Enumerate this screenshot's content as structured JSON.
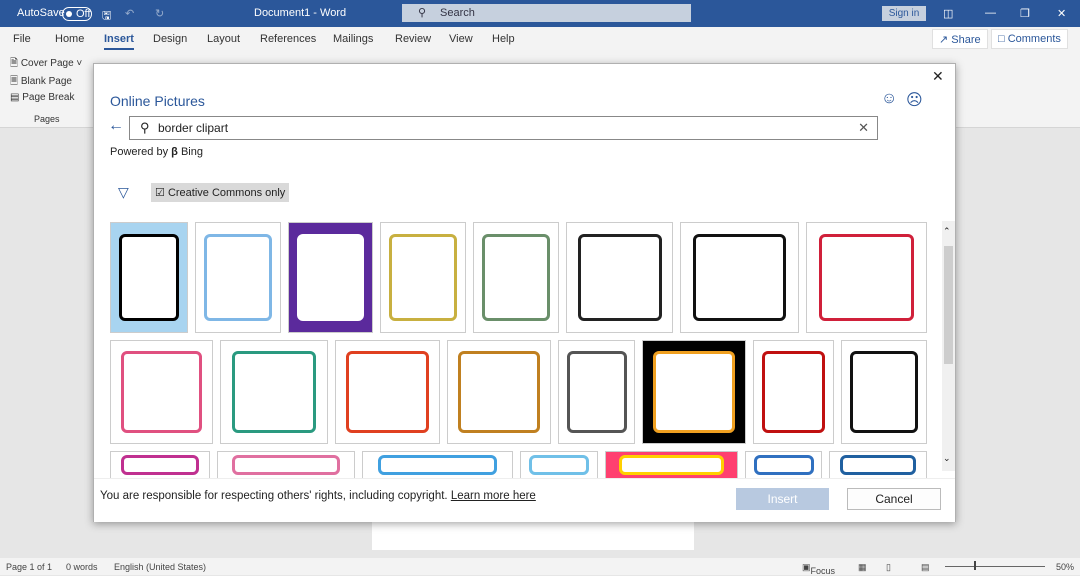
{
  "titlebar": {
    "autosave": "AutoSave",
    "toggle": "Off",
    "doc_title": "Document1 - Word",
    "search": "Search",
    "signin": "Sign in"
  },
  "tabs": [
    "File",
    "Home",
    "Insert",
    "Design",
    "Layout",
    "References",
    "Mailings",
    "Review",
    "View",
    "Help"
  ],
  "active_tab": "Insert",
  "share": "Share",
  "comments": "Comments",
  "ribbon": {
    "items": [
      "Cover Page",
      "Blank Page",
      "Page Break"
    ],
    "group": "Pages"
  },
  "dialog": {
    "title": "Online Pictures",
    "search_value": "border clipart",
    "powered_by": "Powered by",
    "bing": "Bing",
    "filter_label": "Creative Commons only",
    "filter_checked": true,
    "disclaimer": "You are responsible for respecting others' rights, including copyright.",
    "learn_more": "Learn more here",
    "insert": "Insert",
    "cancel": "Cancel"
  },
  "thumbnails": [
    [
      "#a8d4f0",
      "#000"
    ],
    [
      "#fff",
      "#7fb7e6"
    ],
    [
      "#5b2a9c",
      "#fff"
    ],
    [
      "#fff",
      "#c8b040"
    ],
    [
      "#fff",
      "#6a8f6a"
    ],
    [
      "#fff",
      "#222"
    ],
    [
      "#fff",
      "#111"
    ],
    [
      "#fff",
      "#d0203a"
    ],
    [
      "#fff",
      "#e05080"
    ],
    [
      "#fff",
      "#2a9a80"
    ],
    [
      "#fff",
      "#e04020"
    ],
    [
      "#fff",
      "#c08020"
    ],
    [
      "#fff",
      "#555"
    ],
    [
      "#000",
      "#f0a020"
    ],
    [
      "#fff",
      "#c01010"
    ],
    [
      "#fff",
      "#111"
    ],
    [
      "#fff",
      "#c03090"
    ],
    [
      "#fff",
      "#e070a0"
    ],
    [
      "#fff",
      "#40a0e0"
    ],
    [
      "#fff",
      "#70c0e8"
    ],
    [
      "#ff4070",
      "#ffd000"
    ],
    [
      "#fff",
      "#3070c0"
    ],
    [
      "#fff",
      "#2060a0"
    ]
  ],
  "status": {
    "page": "Page 1 of 1",
    "words": "0 words",
    "language": "English (United States)",
    "focus": "Focus",
    "zoom": "50%"
  },
  "colors": {
    "brand": "#2b579a",
    "insert_disabled": "#b8c9e0"
  }
}
